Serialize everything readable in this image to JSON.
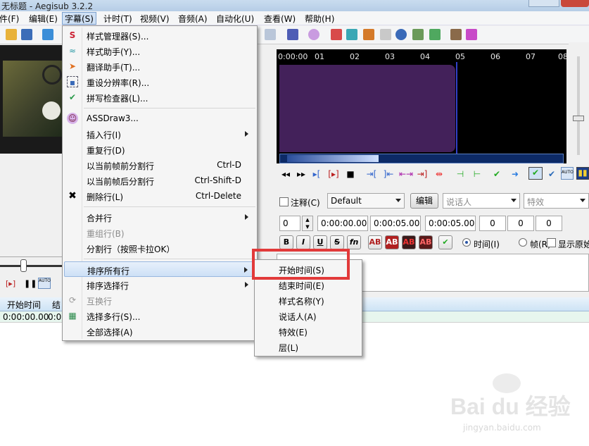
{
  "window": {
    "title": "无标题 - Aegisub 3.2.2"
  },
  "menubar": {
    "items": [
      "件(F)",
      "编辑(E)",
      "字幕(S)",
      "计时(T)",
      "视频(V)",
      "音频(A)",
      "自动化(U)",
      "查看(W)",
      "帮助(H)"
    ]
  },
  "subtitle_menu": {
    "items": [
      {
        "icon": "style-manager-icon",
        "label": "样式管理器(S)..."
      },
      {
        "icon": "style-assistant-icon",
        "label": "样式助手(Y)..."
      },
      {
        "icon": "translation-assistant-icon",
        "label": "翻译助手(T)..."
      },
      {
        "icon": "resample-resolution-icon",
        "label": "重设分辨率(R)..."
      },
      {
        "icon": "spell-checker-icon",
        "label": "拼写检查器(L)..."
      },
      {
        "icon": "assdraw-icon",
        "label": "ASSDraw3..."
      },
      {
        "label": "插入行(I)"
      },
      {
        "label": "重复行(D)"
      },
      {
        "label": "以当前帧前分割行",
        "shortcut": "Ctrl-D"
      },
      {
        "label": "以当前帧后分割行",
        "shortcut": "Ctrl-Shift-D"
      },
      {
        "icon": "delete-icon",
        "label": "删除行(L)",
        "shortcut": "Ctrl-Delete"
      },
      {
        "label": "合并行"
      },
      {
        "label": "重组行(B)"
      },
      {
        "label": "分割行（按照卡拉OK）"
      },
      {
        "label": "排序所有行"
      },
      {
        "label": "排序选择行"
      },
      {
        "icon": "swap-lines-icon",
        "label": "互换行"
      },
      {
        "icon": "select-lines-icon",
        "label": "选择多行(S)..."
      },
      {
        "label": "全部选择(A)"
      }
    ]
  },
  "sort_submenu": {
    "items": [
      "开始时间(S)",
      "结束时间(E)",
      "样式名称(Y)",
      "说话人(A)",
      "特效(E)",
      "层(L)"
    ]
  },
  "audio": {
    "ticks": [
      "0:00:00",
      "01",
      "02",
      "03",
      "04",
      "05",
      "06",
      "07",
      "08"
    ]
  },
  "edit": {
    "comment_label": "注释(C)",
    "style_value": "Default",
    "edit_button": "编辑",
    "actor_placeholder": "说话人",
    "effect_placeholder": "特效",
    "layer": "0",
    "start_time": "0:00:00.00",
    "end_time": "0:00:05.00",
    "duration": "0:00:05.00",
    "margin_l": "0",
    "margin_r": "0",
    "margin_v": "0",
    "comment_checkbox_label": "显示原始",
    "time_radio": "时间(I)",
    "frame_radio": "帧(R)",
    "fmt": {
      "bold": "B",
      "italic": "I",
      "underline": "U",
      "strike": "S",
      "fn": "fn",
      "ab": "AB"
    }
  },
  "grid": {
    "headers": [
      "开始时间",
      "结"
    ],
    "rows": [
      [
        "0:00:00.00",
        "0:0"
      ]
    ]
  },
  "watermark": {
    "brand": "Bai du 经验",
    "url": "jingyan.baidu.com"
  }
}
